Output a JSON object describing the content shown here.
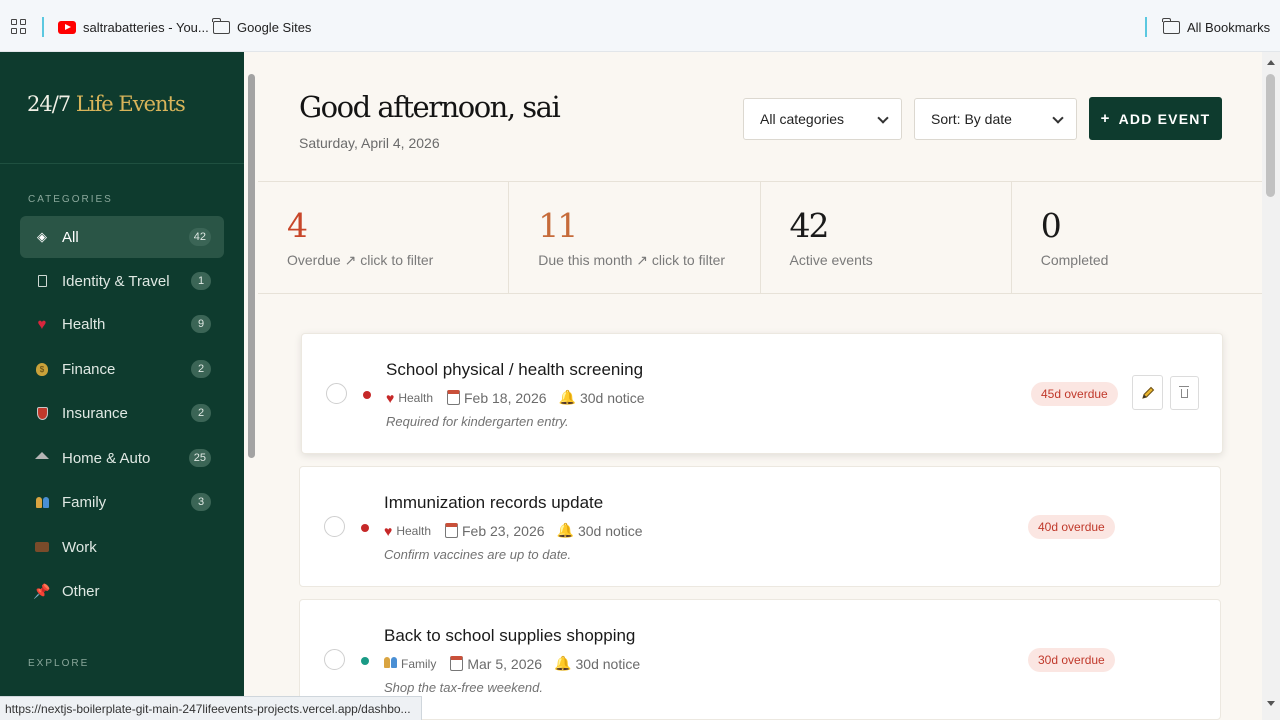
{
  "bookmarks": {
    "items": [
      {
        "label": "saltrabatteries - You...",
        "icon": "youtube-icon"
      },
      {
        "label": "Google Sites",
        "icon": "folder-icon"
      }
    ],
    "all_bookmarks": "All Bookmarks"
  },
  "sidebar": {
    "logo_prefix": "24/7",
    "logo_accent": "Life Events",
    "categories_heading": "CATEGORIES",
    "explore_heading": "EXPLORE",
    "items": [
      {
        "label": "All",
        "count": "42",
        "icon": "diamond-icon"
      },
      {
        "label": "Identity & Travel",
        "count": "1",
        "icon": "passport-icon"
      },
      {
        "label": "Health",
        "count": "9",
        "icon": "heart-icon"
      },
      {
        "label": "Finance",
        "count": "2",
        "icon": "money-bag-icon"
      },
      {
        "label": "Insurance",
        "count": "2",
        "icon": "shield-icon"
      },
      {
        "label": "Home & Auto",
        "count": "25",
        "icon": "house-icon"
      },
      {
        "label": "Family",
        "count": "3",
        "icon": "family-icon"
      },
      {
        "label": "Work",
        "icon": "briefcase-icon"
      },
      {
        "label": "Other",
        "icon": "pin-icon"
      }
    ]
  },
  "header": {
    "greeting": "Good afternoon, sai",
    "date": "Saturday, April 4, 2026",
    "category_select": "All categories",
    "sort_select": "Sort: By date",
    "add_button_icon": "+",
    "add_button": "ADD EVENT"
  },
  "stats": [
    {
      "value": "4",
      "label": "Overdue ↗ click to filter"
    },
    {
      "value": "11",
      "label": "Due this month ↗ click to filter"
    },
    {
      "value": "42",
      "label": "Active events"
    },
    {
      "value": "0",
      "label": "Completed"
    }
  ],
  "events": [
    {
      "title": "School physical / health screening",
      "category": "Health",
      "date": "Feb 18, 2026",
      "notice": "30d notice",
      "note": "Required for kindergarten entry.",
      "badge": "45d overdue",
      "dot_color": "#c62828"
    },
    {
      "title": "Immunization records update",
      "category": "Health",
      "date": "Feb 23, 2026",
      "notice": "30d notice",
      "note": "Confirm vaccines are up to date.",
      "badge": "40d overdue",
      "dot_color": "#c62828"
    },
    {
      "title": "Back to school supplies shopping",
      "category": "Family",
      "date": "Mar 5, 2026",
      "notice": "30d notice",
      "note": "Shop the tax-free weekend.",
      "badge": "30d overdue",
      "dot_color": "#1a9a85"
    }
  ],
  "status_url": "https://nextjs-boilerplate-git-main-247lifeevents-projects.vercel.app/dashbo...",
  "colors": {
    "brand": "#0e3b2e",
    "accent": "#d8b45a",
    "overdue": "#c0392b"
  }
}
